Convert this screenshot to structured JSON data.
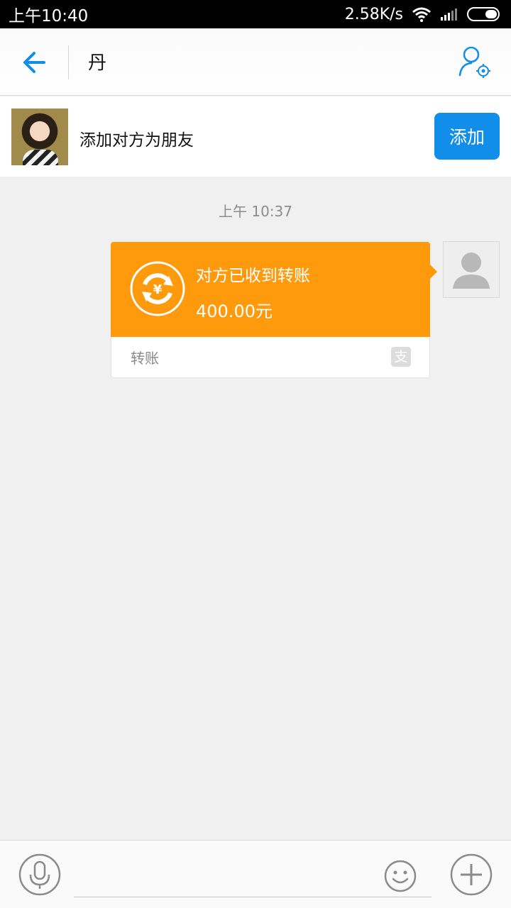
{
  "status_bar": {
    "time": "上午10:40",
    "network_speed": "2.58K/s"
  },
  "header": {
    "title": "丹"
  },
  "add_friend": {
    "text": "添加对方为朋友",
    "button_label": "添加"
  },
  "chat": {
    "timestamp": "上午 10:37",
    "transfer_message": {
      "status": "对方已收到转账",
      "amount": "400.00元",
      "type_label": "转账",
      "brand_glyph": "支"
    }
  },
  "input_bar": {
    "placeholder": ""
  },
  "colors": {
    "accent": "#108ee9",
    "transfer_orange": "#ff9a0d"
  }
}
